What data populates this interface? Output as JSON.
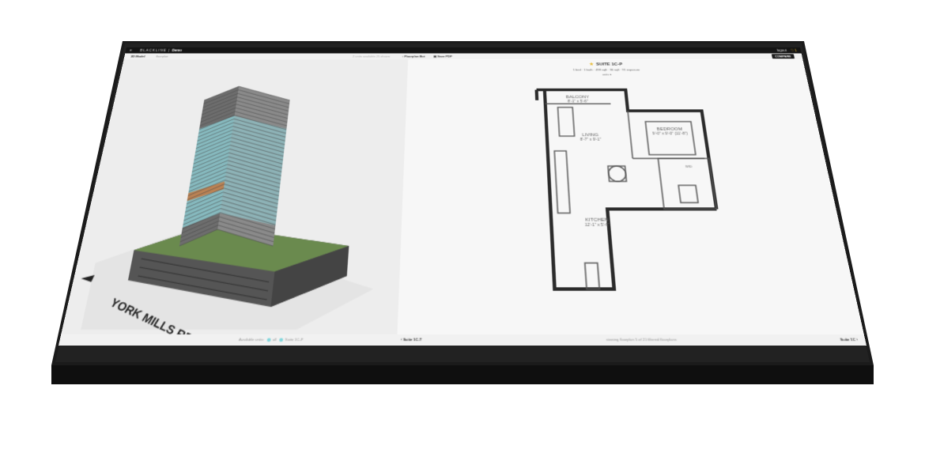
{
  "topbar": {
    "menu_icon": "hamburger-icon",
    "brand_name": "BLACKLINE",
    "brand_product": "Demo",
    "logout_label": "logout",
    "favorites_count": "1",
    "favorites_icon": "heart-icon"
  },
  "subbar": {
    "tab_3d_model": "3D Model",
    "tab_floorplan": "floorplan",
    "units_available": "2 units available",
    "units_shown": "25 shown",
    "floorplan_button": "Floorplan Bot",
    "pdf_button": "Save PDF",
    "compare_button": "COMPARE"
  },
  "model": {
    "street_label": "YORK MILLS RD",
    "accent_color": "#7fd6dc"
  },
  "suite": {
    "title": "SUITE 1C-P",
    "meta": "1 bed · 1 bath · 498 sqft · 36 sqft · 91 exposure",
    "units": "units ▾"
  },
  "floorplan": {
    "balcony": "BALCONY",
    "balcony_dims": "8'-1\" x 5'-6\"",
    "living": "LIVING",
    "living_dims": "8'-7\" x 9'-1\"",
    "bedroom": "BEDROOM",
    "bedroom_dims": "9'-0\" x 9'-0\" (11'-8\")",
    "kitchen": "KITCHEN",
    "kitchen_dims": "12'-1\" x 5'-6\"",
    "wd": "W/D"
  },
  "bottombar": {
    "available_label": "Available units:",
    "legend_all": "all",
    "legend_suite": "Suite 1C-P",
    "prev_suite": "‹ Suite 1C-T",
    "viewing": "viewing floorplan 5 of 21 filtered floorplans",
    "next_suite": "Suite 1C ›"
  }
}
